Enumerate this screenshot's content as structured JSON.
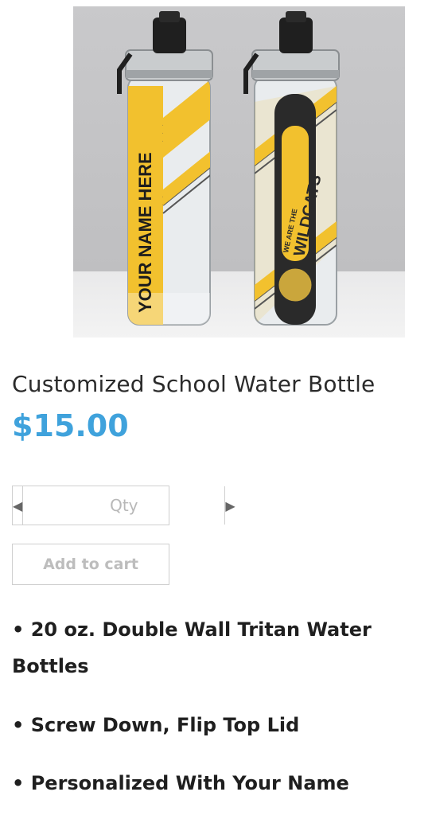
{
  "product": {
    "image_alt": "Customized school water bottles",
    "bottle_left_text": "YOUR NAME HERE",
    "bottle_right_text_top": "WE ARE THE",
    "bottle_right_text_main": "WILDCATS",
    "title": "Customized School Water Bottle",
    "price": "$15.00"
  },
  "quantity": {
    "placeholder": "Qty",
    "decrement_icon": "caret-left-icon",
    "increment_icon": "caret-right-icon"
  },
  "actions": {
    "add_to_cart_label": "Add to cart"
  },
  "features": [
    "• 20 oz. Double Wall Tritan Water Bottles",
    "• Screw Down, Flip Top Lid",
    "• Personalized With Your Name"
  ],
  "colors": {
    "price": "#3fa2dc",
    "bottle_yellow": "#f2c12e"
  }
}
